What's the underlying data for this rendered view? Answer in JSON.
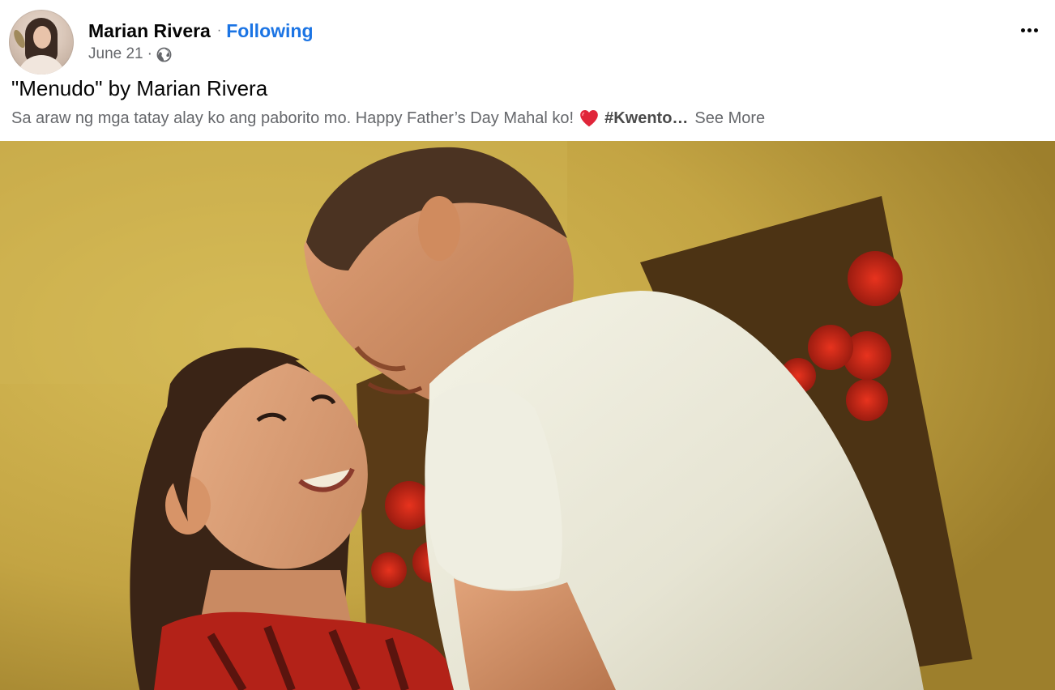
{
  "author": {
    "name": "Marian Rivera",
    "follow_status": "Following"
  },
  "meta": {
    "date": "June 21",
    "separator": "·",
    "audience_icon": "globe-icon"
  },
  "post": {
    "title": "\"Menudo\" by Marian Rivera",
    "caption_text": "Sa araw ng mga tatay alay ko ang paborito mo. Happy Father’s Day Mahal ko!",
    "caption_emoji": "heart-icon",
    "hashtag": "#Kwento…",
    "see_more": "See More"
  },
  "menu": {
    "icon": "more-horizontal-icon"
  },
  "colors": {
    "link_blue": "#1b74e4",
    "secondary_text": "#65676b",
    "primary_text": "#050505",
    "heart_red": "#e0263a"
  }
}
